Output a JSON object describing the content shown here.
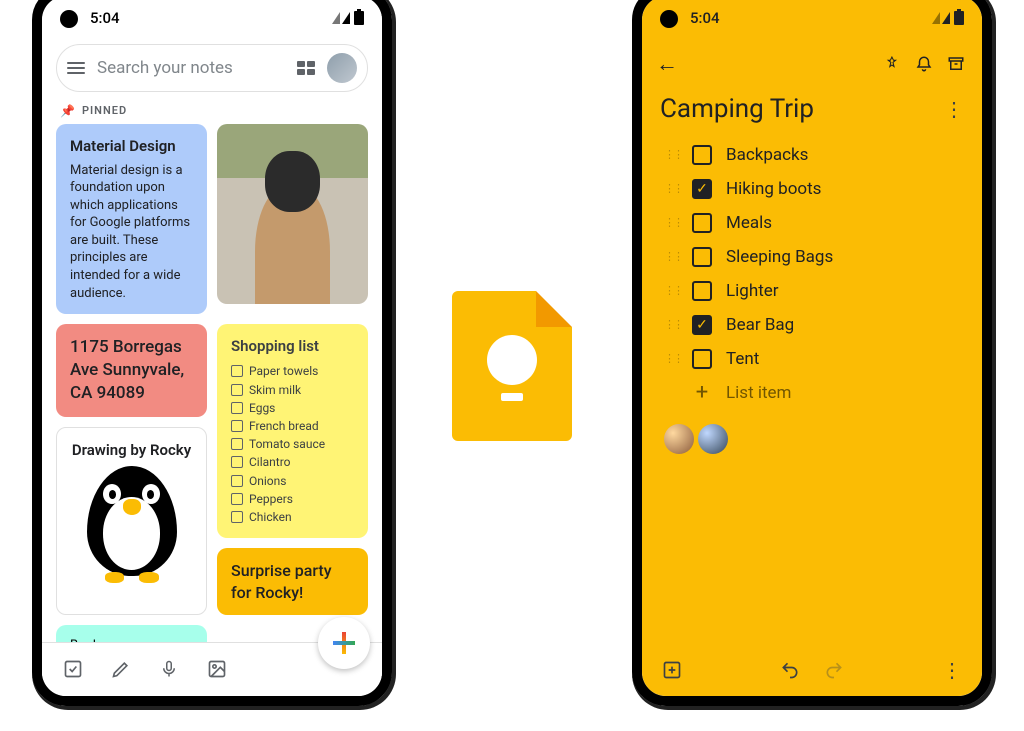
{
  "status": {
    "time": "5:04"
  },
  "left": {
    "search_placeholder": "Search your notes",
    "pinned_label": "PINNED",
    "card_material": {
      "title": "Material Design",
      "body": "Material design is a foundation upon which applications for Google platforms are built. These principles are intended for a wide audience."
    },
    "card_address": "1175 Borregas Ave Sunnyvale, CA 94089",
    "card_drawing_title": "Drawing by Rocky",
    "card_shopping": {
      "title": "Shopping list",
      "items": [
        "Paper towels",
        "Skim milk",
        "Eggs",
        "French bread",
        "Tomato sauce",
        "Cilantro",
        "Onions",
        "Peppers",
        "Chicken"
      ]
    },
    "card_surprise": "Surprise party for Rocky!",
    "card_books": "Books"
  },
  "right": {
    "title": "Camping Trip",
    "items": [
      {
        "label": "Backpacks",
        "checked": false
      },
      {
        "label": "Hiking boots",
        "checked": true
      },
      {
        "label": "Meals",
        "checked": false
      },
      {
        "label": "Sleeping Bags",
        "checked": false
      },
      {
        "label": "Lighter",
        "checked": false
      },
      {
        "label": "Bear Bag",
        "checked": true
      },
      {
        "label": "Tent",
        "checked": false
      }
    ],
    "add_item_label": "List item"
  }
}
